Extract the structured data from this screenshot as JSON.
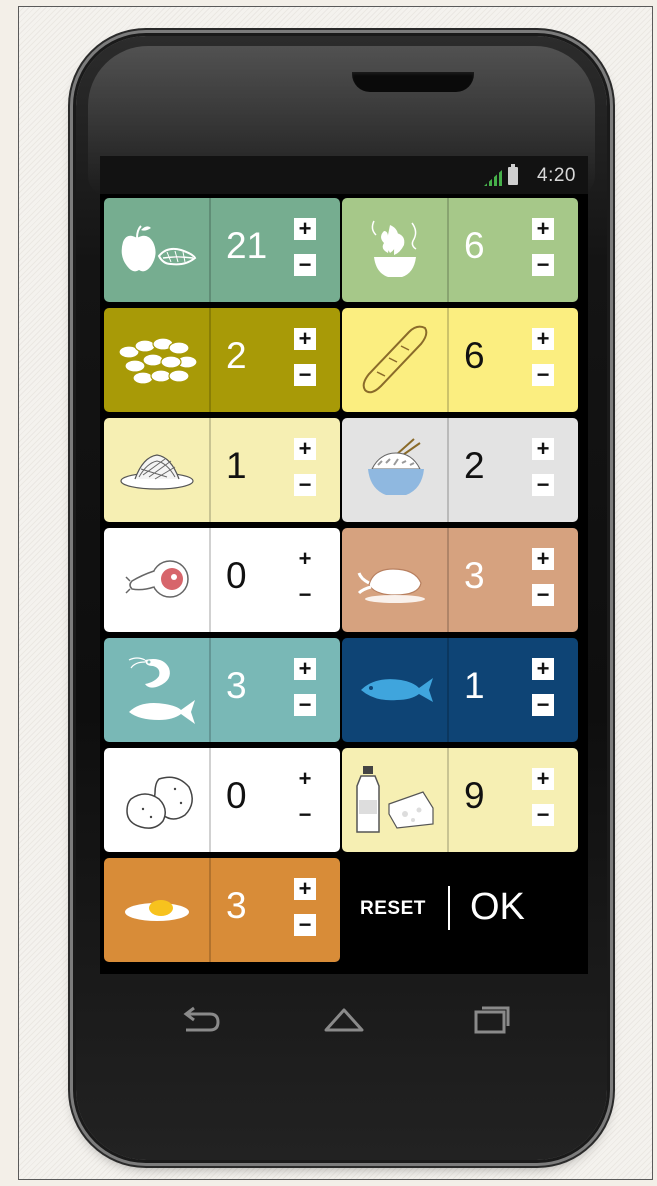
{
  "status_bar": {
    "time": "4:20",
    "signal_icon": "signal-icon",
    "battery_icon": "battery-icon"
  },
  "food_tiles": [
    {
      "id": "fruit-veg",
      "icon": "apple-leaf-icon",
      "value": "21",
      "bg": "#76ad90",
      "theme": "dark",
      "buttons": "boxed"
    },
    {
      "id": "cooked-veg",
      "icon": "salad-bowl-icon",
      "value": "6",
      "bg": "#a6c889",
      "theme": "dark",
      "buttons": "boxed"
    },
    {
      "id": "legumes",
      "icon": "beans-icon",
      "value": "2",
      "bg": "#a89a07",
      "theme": "dark",
      "buttons": "boxed"
    },
    {
      "id": "bread",
      "icon": "baguette-icon",
      "value": "6",
      "bg": "#fbee80",
      "theme": "light",
      "buttons": "boxed"
    },
    {
      "id": "pasta",
      "icon": "pasta-plate-icon",
      "value": "1",
      "bg": "#f6efb3",
      "theme": "light",
      "buttons": "boxed"
    },
    {
      "id": "rice",
      "icon": "rice-bowl-icon",
      "value": "2",
      "bg": "#e3e3e3",
      "theme": "light",
      "buttons": "boxed"
    },
    {
      "id": "meat",
      "icon": "ham-icon",
      "value": "0",
      "bg": "#ffffff",
      "theme": "light",
      "buttons": "plain"
    },
    {
      "id": "poultry",
      "icon": "roast-chicken-icon",
      "value": "3",
      "bg": "#d6a27f",
      "theme": "dark",
      "buttons": "boxed"
    },
    {
      "id": "seafood",
      "icon": "shrimp-fish-icon",
      "value": "3",
      "bg": "#79b8b6",
      "theme": "dark",
      "buttons": "boxed"
    },
    {
      "id": "fish",
      "icon": "fish-icon",
      "value": "1",
      "bg": "#0e4475",
      "theme": "dark",
      "buttons": "boxed"
    },
    {
      "id": "potatoes",
      "icon": "potato-icon",
      "value": "0",
      "bg": "#ffffff",
      "theme": "light",
      "buttons": "plain"
    },
    {
      "id": "dairy",
      "icon": "milk-cheese-icon",
      "value": "9",
      "bg": "#f6efb3",
      "theme": "light",
      "buttons": "boxed"
    },
    {
      "id": "eggs",
      "icon": "fried-egg-icon",
      "value": "3",
      "bg": "#d88c38",
      "theme": "dark",
      "buttons": "boxed"
    }
  ],
  "controls": {
    "plus": "+",
    "minus": "−"
  },
  "actions": {
    "reset": "RESET",
    "ok": "OK"
  },
  "nav_bar": {
    "back_icon": "back-icon",
    "home_icon": "home-icon",
    "recents_icon": "recents-icon"
  }
}
